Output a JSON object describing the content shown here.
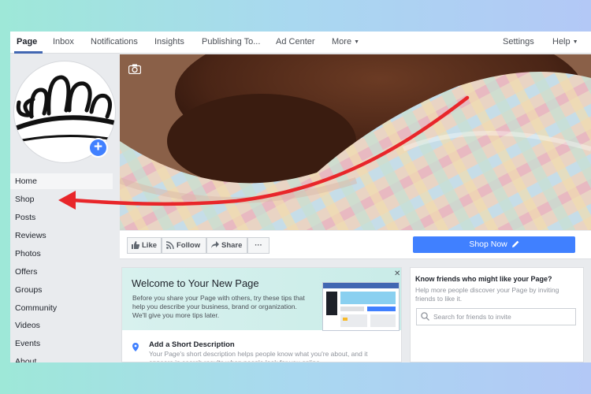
{
  "nav": {
    "items": [
      "Page",
      "Inbox",
      "Notifications",
      "Insights",
      "Publishing To...",
      "Ad Center",
      "More",
      "Settings",
      "Help"
    ],
    "active": "Page"
  },
  "sidebar": {
    "items": [
      "Home",
      "Shop",
      "Posts",
      "Reviews",
      "Photos",
      "Offers",
      "Groups",
      "Community",
      "Videos",
      "Events",
      "About"
    ],
    "active": "Home"
  },
  "actions": {
    "like": "Like",
    "follow": "Follow",
    "share": "Share",
    "more": "···",
    "shop_now": "Shop Now"
  },
  "welcome": {
    "title": "Welcome to Your New Page",
    "body": "Before you share your Page with others, try these tips that help you describe your business, brand or organization. We'll give you more tips later.",
    "close": "✕",
    "short_title": "Add a Short Description",
    "short_body": "Your Page's short description helps people know what you're about, and it appears in search results when people look for you online."
  },
  "friends": {
    "title": "Know friends who might like your Page?",
    "body": "Help more people discover your Page by inviting friends to like it.",
    "search_placeholder": "Search for friends to invite"
  },
  "colors": {
    "accent": "#4080ff",
    "annotation_arrow": "#e8262a"
  },
  "icons": [
    "camera-icon",
    "plus-icon",
    "like-icon",
    "rss-icon",
    "share-icon",
    "pencil-icon",
    "close-icon",
    "location-pin-icon",
    "search-icon"
  ]
}
